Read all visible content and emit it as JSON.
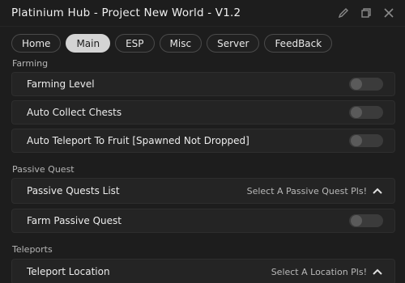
{
  "window": {
    "title": "Platinium Hub - Project New World - V1.2",
    "icons": [
      "edit-icon",
      "restore-icon",
      "close-icon"
    ]
  },
  "tabs": [
    {
      "label": "Home",
      "active": false
    },
    {
      "label": "Main",
      "active": true
    },
    {
      "label": "ESP",
      "active": false
    },
    {
      "label": "Misc",
      "active": false
    },
    {
      "label": "Server",
      "active": false
    },
    {
      "label": "FeedBack",
      "active": false
    }
  ],
  "sections": {
    "farming": {
      "label": "Farming",
      "farming_level": {
        "label": "Farming Level",
        "enabled": false
      },
      "auto_collect_chests": {
        "label": "Auto Collect Chests",
        "enabled": false
      },
      "auto_teleport_fruit": {
        "label": "Auto Teleport To Fruit [Spawned Not Dropped]",
        "enabled": false
      }
    },
    "passive_quest": {
      "label": "Passive Quest",
      "quests_list": {
        "label": "Passive Quests List",
        "value": "Select A Passive Quest Pls!"
      },
      "farm_passive_quest": {
        "label": "Farm Passive Quest",
        "enabled": false
      }
    },
    "teleports": {
      "label": "Teleports",
      "teleport_location": {
        "label": "Teleport Location",
        "value": "Select A Location Pls!"
      }
    }
  },
  "colors": {
    "background": "#1d1d1d",
    "row": "#242424",
    "active_tab": "#d4d4d4",
    "toggle_off": "#3b3b3b"
  }
}
